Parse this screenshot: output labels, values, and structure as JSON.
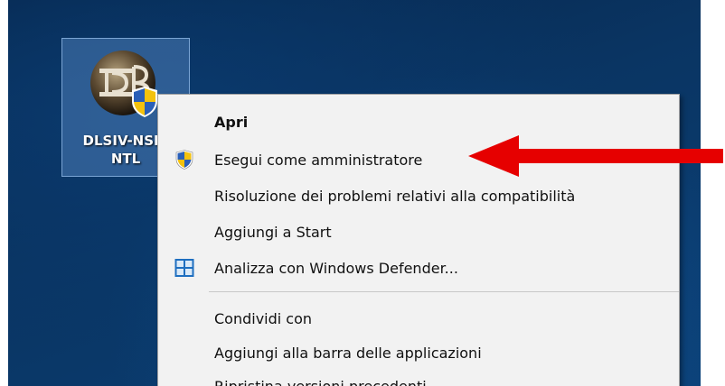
{
  "desktop_icon": {
    "label": "DLSIV-NSIS\nNTL"
  },
  "context_menu": {
    "items": [
      {
        "label": "Apri",
        "bold": true,
        "icon": ""
      },
      {
        "label": "Esegui come amministratore",
        "bold": false,
        "icon": "uac-shield-icon"
      },
      {
        "label": "Risoluzione dei problemi relativi alla compatibilità",
        "bold": false,
        "icon": ""
      },
      {
        "label": "Aggiungi a Start",
        "bold": false,
        "icon": ""
      },
      {
        "label": "Analizza con Windows Defender...",
        "bold": false,
        "icon": "windows-defender-icon"
      },
      {
        "label": "Condividi con",
        "bold": false,
        "icon": ""
      },
      {
        "label": "Aggiungi alla barra delle applicazioni",
        "bold": false,
        "icon": ""
      },
      {
        "label": "Ripristina versioni precedenti",
        "bold": false,
        "icon": ""
      }
    ]
  },
  "colors": {
    "arrow": "#e60000",
    "menu_background": "#f2f2f2",
    "selection_tile": "#5a8cc8"
  }
}
